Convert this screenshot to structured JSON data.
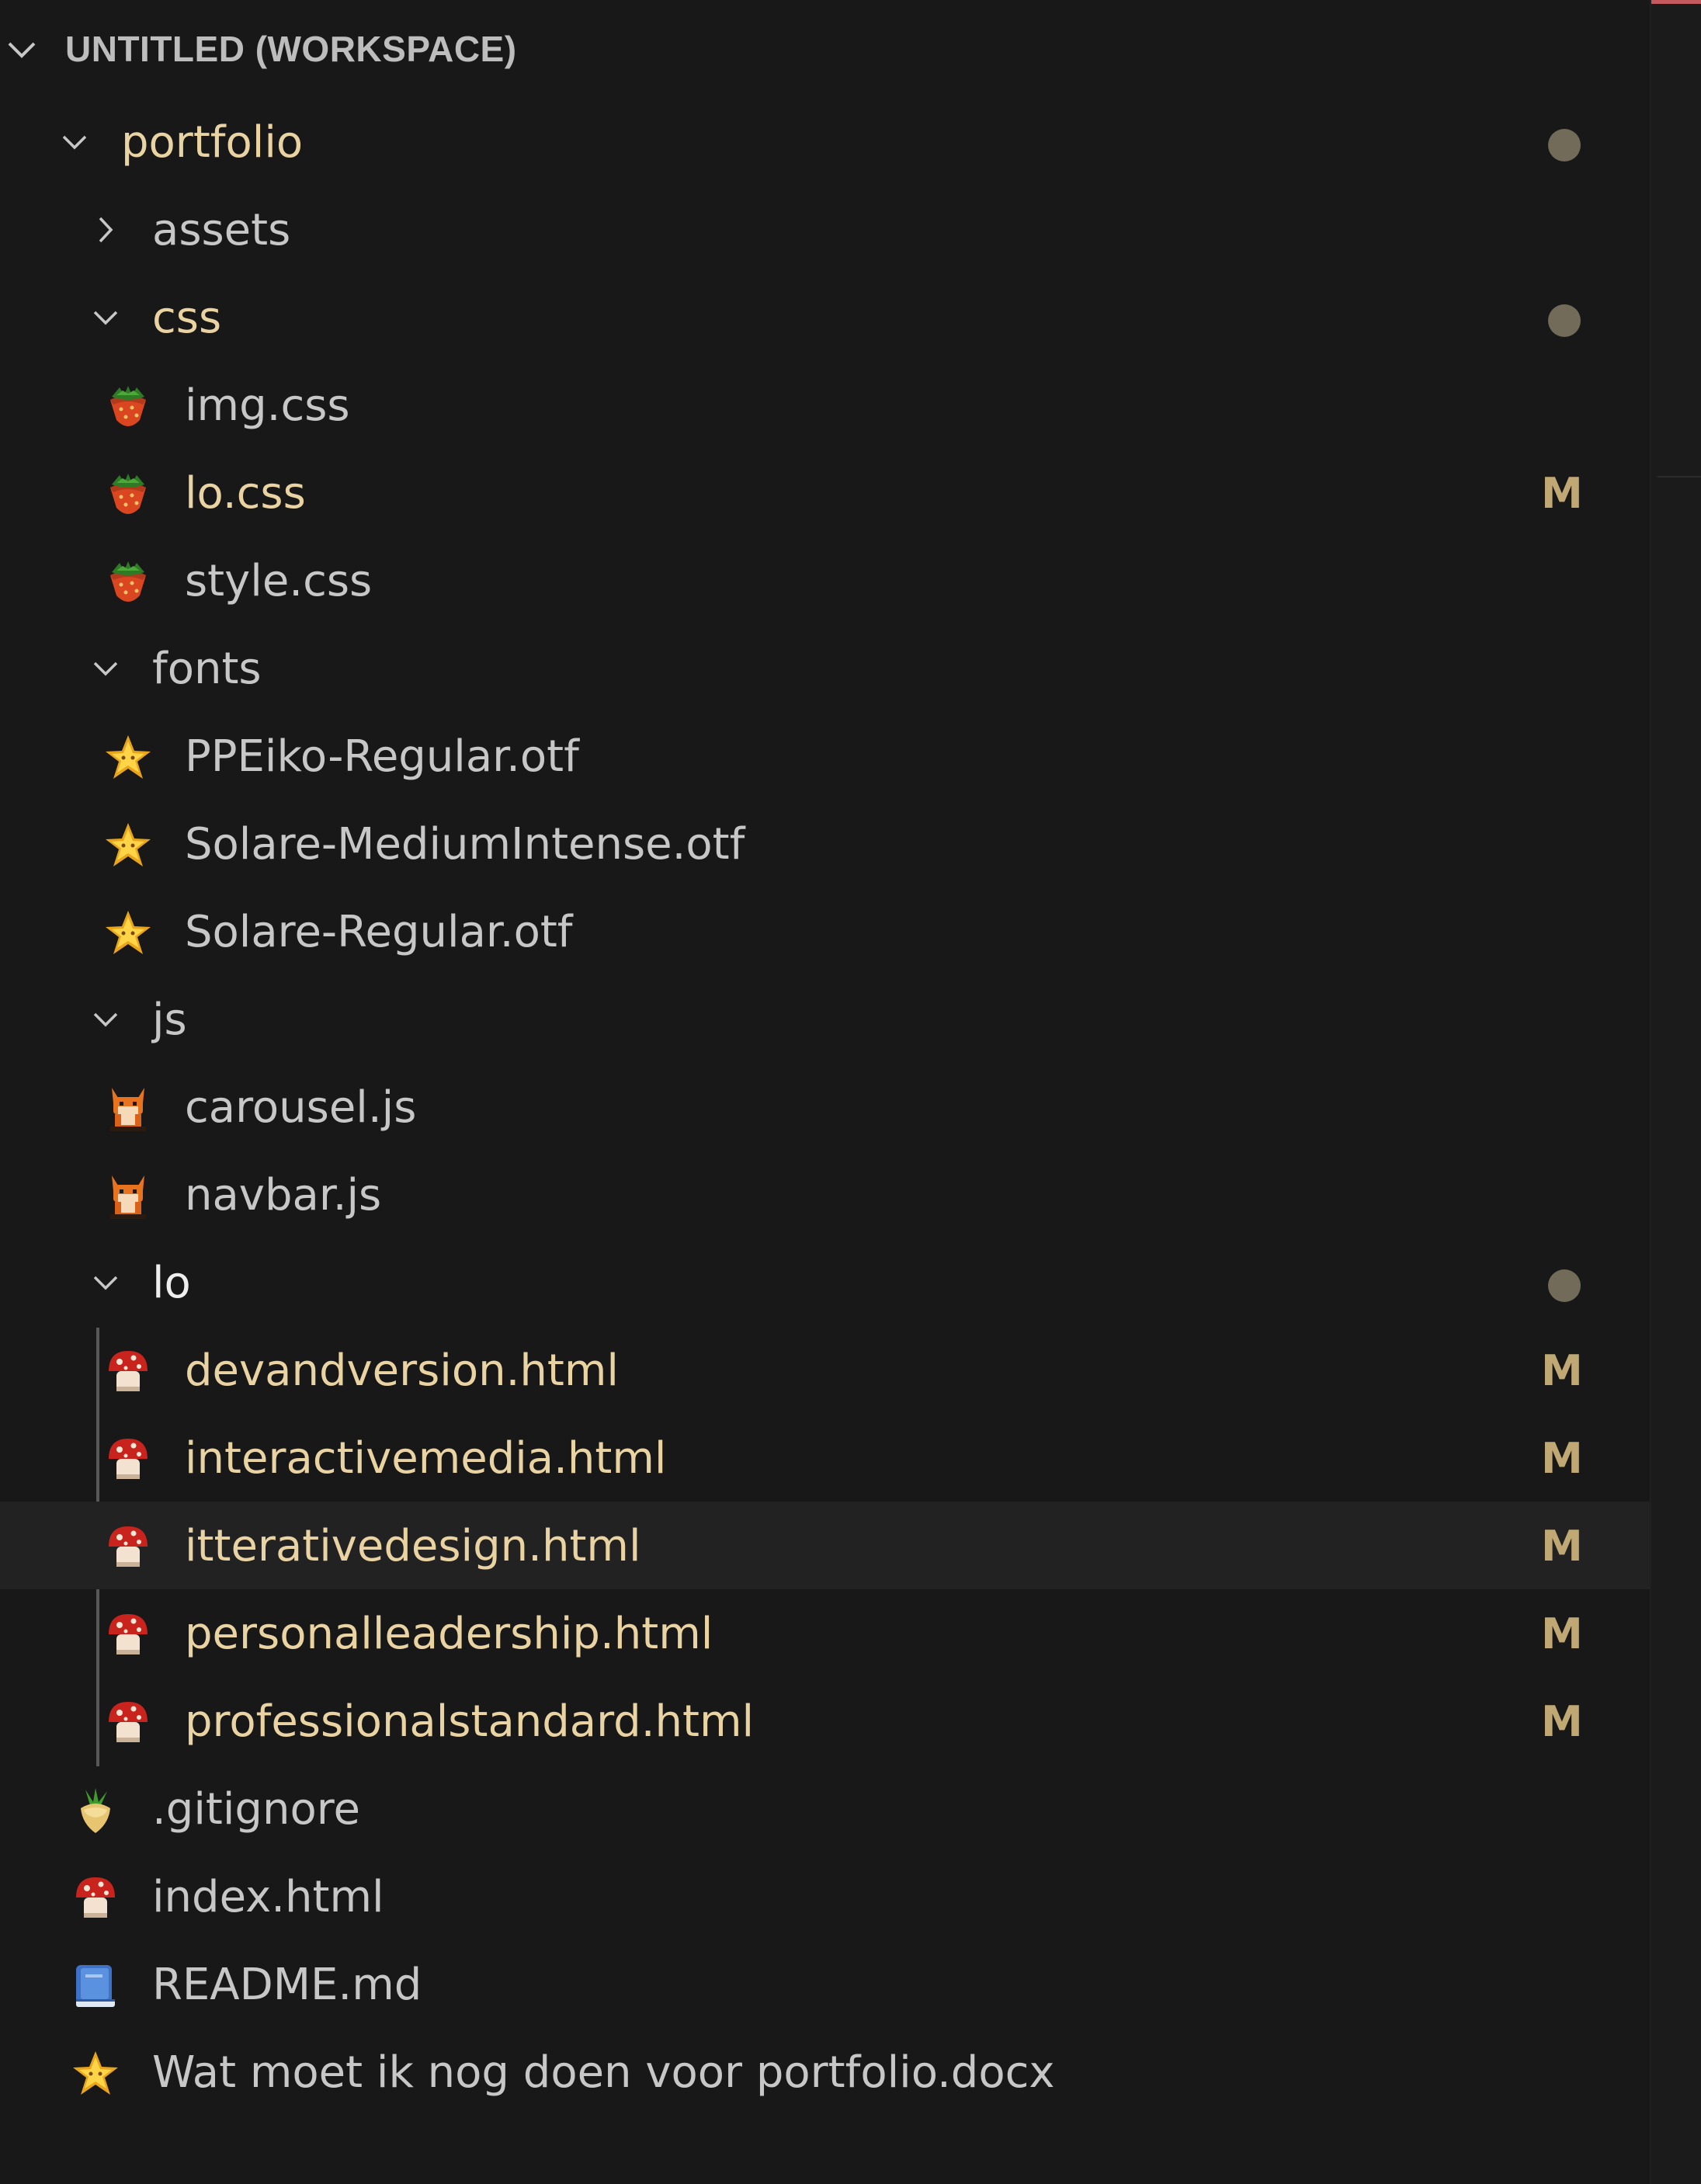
{
  "workspace": {
    "title": "UNTITLED (WORKSPACE)"
  },
  "tree": {
    "portfolio": "portfolio",
    "assets": "assets",
    "css": "css",
    "img_css": "img.css",
    "lo_css": "lo.css",
    "style_css": "style.css",
    "fonts": "fonts",
    "ppeiko": "PPEiko-Regular.otf",
    "solare_medium": "Solare-MediumIntense.otf",
    "solare_regular": "Solare-Regular.otf",
    "js": "js",
    "carousel": "carousel.js",
    "navbar": "navbar.js",
    "lo": "lo",
    "devandversion": "devandversion.html",
    "interactivemedia": "interactivemedia.html",
    "itterativedesign": "itterativedesign.html",
    "personalleadership": "personalleadership.html",
    "professionalstandard": "professionalstandard.html",
    "gitignore": ".gitignore",
    "index": "index.html",
    "readme": "README.md",
    "docx": "Wat moet ik nog doen voor portfolio.docx"
  },
  "badges": {
    "modified": "M"
  },
  "icons": {
    "chevron_down": "chevron-down-icon",
    "chevron_right": "chevron-right-icon",
    "css_file": "strawberry-icon",
    "font_file": "star-icon",
    "js_file": "fox-icon",
    "html_file": "mushroom-icon",
    "gitignore_file": "turnip-icon",
    "markdown_file": "book-icon"
  },
  "colors": {
    "background": "#181818",
    "text": "#c7c7c7",
    "modified_text": "#ead3a2",
    "modified_badge": "#bfa873",
    "pending_dot": "#736b59",
    "hover_row": "#222222"
  }
}
